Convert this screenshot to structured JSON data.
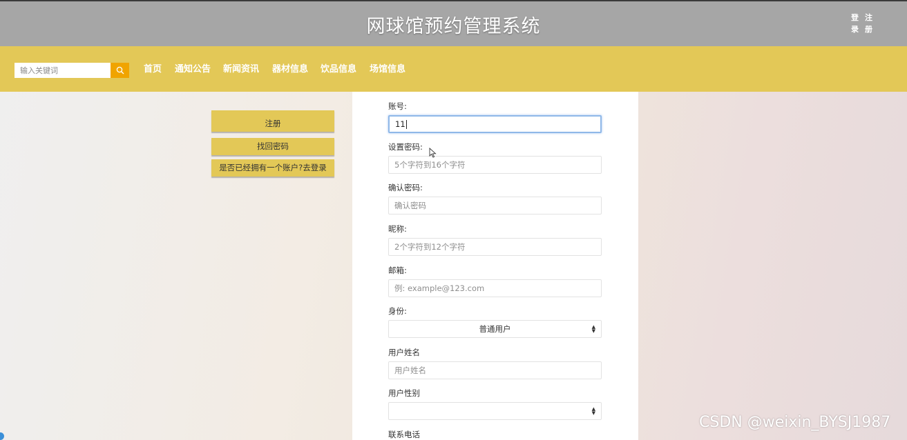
{
  "header": {
    "title": "网球馆预约管理系统",
    "login_label": "登录",
    "register_label": "注册"
  },
  "nav": {
    "search_placeholder": "输入关键词",
    "items": [
      "首页",
      "通知公告",
      "新闻资讯",
      "器材信息",
      "饮品信息",
      "场馆信息"
    ]
  },
  "side": {
    "register_label": "注册",
    "forgot_label": "找回密码",
    "login_prompt": "是否已经拥有一个账户?去登录"
  },
  "form": {
    "account": {
      "label": "账号:",
      "value": "11"
    },
    "password": {
      "label": "设置密码:",
      "placeholder": "5个字符到16个字符"
    },
    "confirm": {
      "label": "确认密码:",
      "placeholder": "确认密码"
    },
    "nickname": {
      "label": "昵称:",
      "placeholder": "2个字符到12个字符"
    },
    "email": {
      "label": "邮箱:",
      "placeholder": "例: example@123.com"
    },
    "role": {
      "label": "身份:",
      "value": "普通用户"
    },
    "realname": {
      "label": "用户姓名",
      "placeholder": "用户姓名"
    },
    "gender": {
      "label": "用户性别",
      "value": ""
    },
    "phone": {
      "label": "联系电话"
    }
  },
  "watermark": "CSDN @weixin_BYSJ1987",
  "colors": {
    "header_bg": "#a6a6a6",
    "nav_bg": "#e3c857",
    "search_btn": "#f0a400"
  }
}
